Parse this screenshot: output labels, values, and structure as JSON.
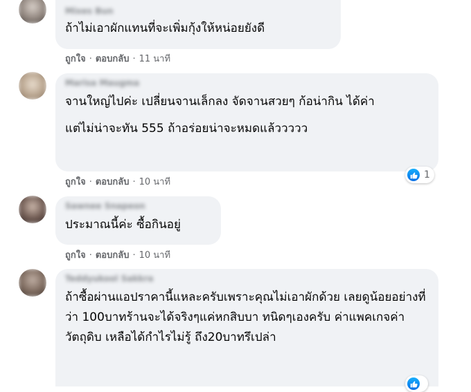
{
  "comments": [
    {
      "author": "Mixes Bun",
      "paragraphs": [
        "ถ้าไม่เอาผักแทนที่จะเพิ่มกุ้งให้หน่อยยังดี"
      ],
      "actions": {
        "like": "ถูกใจ",
        "reply": "ตอบกลับ",
        "sep": "·",
        "time": "11 นาที"
      },
      "avatar_color": "#8a7f78"
    },
    {
      "author": "Marisa Maugma",
      "paragraphs": [
        "จานใหญ่ไปค่ะ เปลี่ยนจานเล็กลง จัดจานสวยๆ ก้อน่ากิน ได้ค่า",
        "แต่ไม่น่าจะทัน 555 ถ้าอร่อยน่าจะหมดแล้ววววว"
      ],
      "actions": {
        "like": "ถูกใจ",
        "reply": "ตอบกลับ",
        "sep": "·",
        "time": "10 นาที"
      },
      "reaction_count": "1",
      "avatar_color": "#b9a58f"
    },
    {
      "author": "Sawnee Snapeon",
      "paragraphs": [
        "ประมาณนี้ค่ะ ซื้อกินอยู่"
      ],
      "actions": {
        "like": "ถูกใจ",
        "reply": "ตอบกลับ",
        "sep": "·",
        "time": "10 นาที"
      },
      "avatar_color": "#6f5a52"
    },
    {
      "author": "Teddyukool Sakkra",
      "paragraphs": [
        "ถ้าซื้อผ่านแอปราคานี้แหละครับเพราะคุณไม่เอาผักด้วย เลยดูน้อยอย่างที่ว่า 100บาทร้านจะได้จริงๆแค่หกสิบบา ทนิดๆเองครับ ค่าแพคเกจค่าวัตถุดิบ เหลือได้กำไรไม่รู้ ถึง20บาทรึเปล่า"
      ],
      "avatar_color": "#7d6a5e"
    }
  ]
}
